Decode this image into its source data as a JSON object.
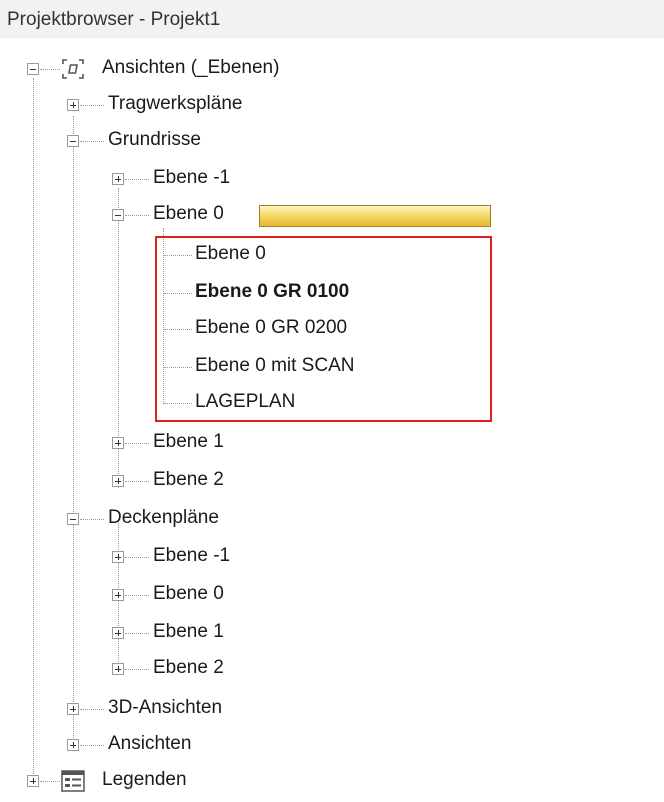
{
  "window": {
    "title": "Projektbrowser - Projekt1"
  },
  "tree": {
    "root": "Ansichten (_Ebenen)",
    "tragwerksplaene": "Tragwerkspläne",
    "grundrisse": "Grundrisse",
    "gr_ebene_m1": "Ebene -1",
    "gr_ebene_0": "Ebene 0",
    "view_ebene_0": "Ebene 0",
    "view_gr0100": "Ebene 0 GR 0100",
    "view_gr0200": "Ebene 0 GR 0200",
    "view_scan": "Ebene 0 mit SCAN",
    "view_lageplan": "LAGEPLAN",
    "gr_ebene_1": "Ebene 1",
    "gr_ebene_2": "Ebene 2",
    "deckenplaene": "Deckenpläne",
    "dp_ebene_m1": "Ebene -1",
    "dp_ebene_0": "Ebene 0",
    "dp_ebene_1": "Ebene 1",
    "dp_ebene_2": "Ebene 2",
    "ansichten_3d": "3D-Ansichten",
    "ansichten": "Ansichten",
    "legenden": "Legenden"
  },
  "colors": {
    "highlight_box": "#e02020",
    "tooltip_bar": "#f5d869"
  },
  "icons": {
    "views": "views-icon",
    "legend": "legend-icon"
  }
}
